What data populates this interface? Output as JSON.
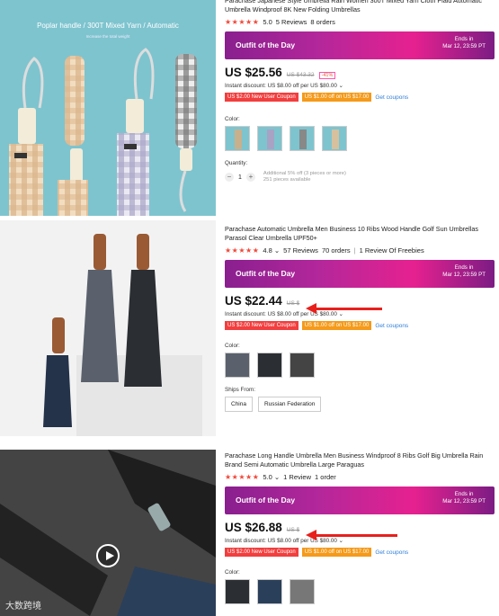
{
  "colors": {
    "price_red": "#f2483a",
    "banner_start": "#8a1f8f",
    "banner_end": "#e6218f",
    "coupon_red": "#f23e3e",
    "coupon_orange": "#f59a1a",
    "link_blue": "#2f7fd8"
  },
  "p1": {
    "image_caption": "Poplar handle / 300T Mixed Yarn / Automatic",
    "image_subcaption": "Increase the total weight",
    "title": "Parachase Japanese Style Umbrella Rain Women 300T Mixed Yarn Cloth Plaid Automatic Umbrella Windproof 8K New Folding Umbrellas",
    "stars": "★★★★★",
    "rating": "5.0",
    "reviews": "5 Reviews",
    "orders": "8 orders",
    "banner": {
      "title": "Outfit of the Day",
      "ends_label": "Ends in",
      "ends_date": "Mar 12, 23:59 PT"
    },
    "price": "US $25.56",
    "old_price": "US $43.32",
    "discount": "-41%",
    "instant": "Instant discount: US $8.00 off per US $80.00 ⌄",
    "coupon1": "US $2.00 New User Coupon",
    "coupon2": "US $1.00 off on US $17.00",
    "get_coupons": "Get coupons",
    "color_label": "Color:",
    "quantity_label": "Quantity:",
    "qty_minus": "−",
    "qty_value": "1",
    "qty_plus": "+",
    "qty_note1": "Additional 5% off (3 pieces or more)",
    "qty_note2": "251 pieces available"
  },
  "p2": {
    "title": "Parachase Automatic Umbrella Men Business 10 Ribs Wood Handle Golf Sun Umbrellas Parasol Clear Umbrella UPF50+",
    "stars": "★★★★★",
    "rating": "4.8 ⌄",
    "reviews": "57 Reviews",
    "orders": "70 orders",
    "freebies": "1 Review Of Freebies",
    "banner": {
      "title": "Outfit of the Day",
      "ends_label": "Ends in",
      "ends_date": "Mar 12, 23:59 PT"
    },
    "price": "US $22.44",
    "old_price": "US $",
    "instant": "Instant discount: US $8.00 off per US $80.00 ⌄",
    "coupon1": "US $2.00 New User Coupon",
    "coupon2": "US $1.00 off on US $17.00",
    "get_coupons": "Get coupons",
    "color_label": "Color:",
    "ships_label": "Ships From:",
    "ship1": "China",
    "ship2": "Russian Federation"
  },
  "p3": {
    "title": "Parachase Long Handle Umbrella Men Business Windproof 8 Ribs Golf Big Umbrella Rain Brand Semi Automatic Umbrella Large Paraguas",
    "stars": "★★★★★",
    "rating": "5.0 ⌄",
    "reviews": "1 Review",
    "orders": "1 order",
    "banner": {
      "title": "Outfit of the Day",
      "ends_label": "Ends in",
      "ends_date": "Mar 12, 23:59 PT"
    },
    "price": "US $26.88",
    "old_price": "US $",
    "instant": "Instant discount: US $8.00 off per US $80.00 ⌄",
    "coupon1": "US $2.00 New User Coupon",
    "coupon2": "US $1.00 off on US $17.00",
    "get_coupons": "Get coupons",
    "color_label": "Color:"
  },
  "watermark": "大数跨境"
}
